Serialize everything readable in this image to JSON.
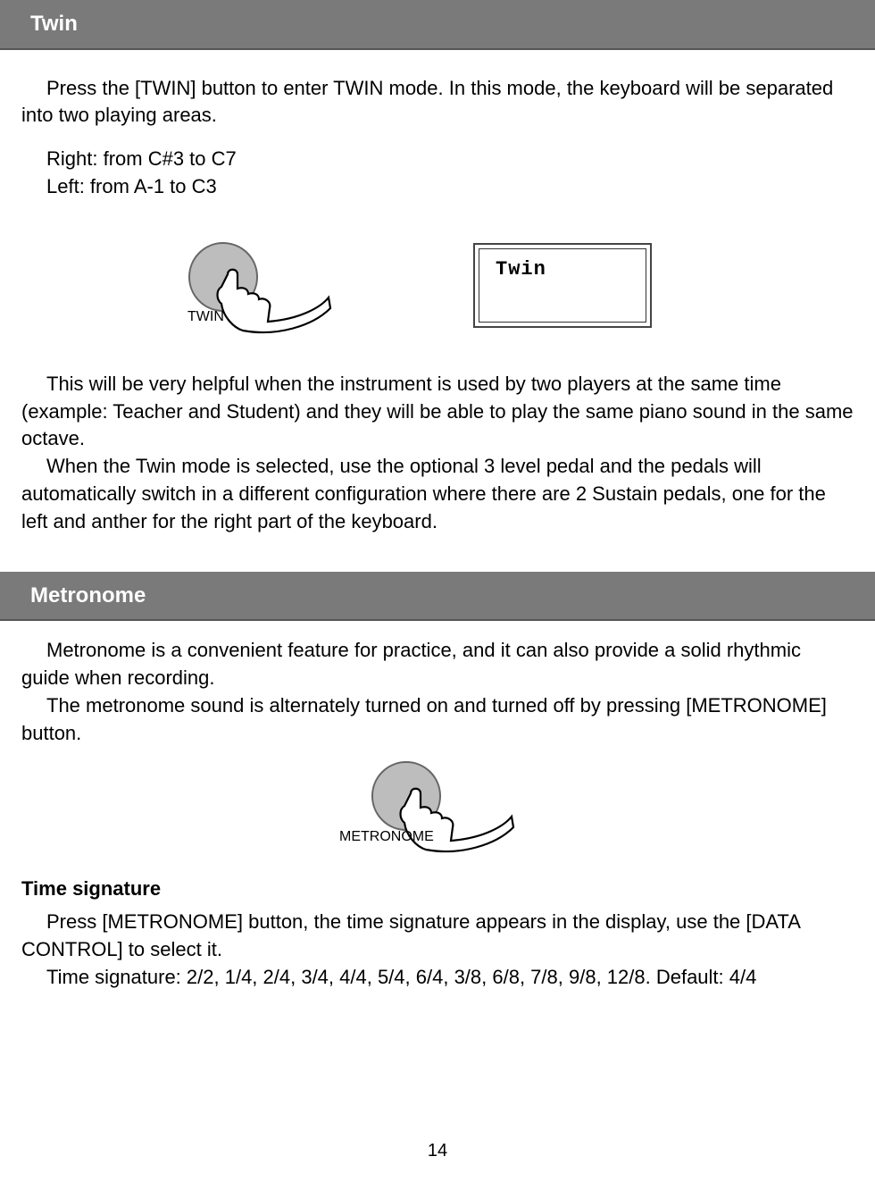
{
  "twin": {
    "header": "Twin",
    "p1": "Press the [TWIN] button to enter TWIN mode. In this mode, the keyboard will be separated into two playing areas.",
    "rangeRight": "Right: from C#3 to C7",
    "rangeLeft": "Left: from A-1 to C3",
    "buttonLabel": "TWIN",
    "lcdText": "Twin",
    "p2a": "This will be very helpful when the instrument is used by two players at the same time (example: Teacher and Student) and they will be able to play the same piano sound in the same octave.",
    "p2b": "When the Twin mode is selected, use the optional 3 level pedal and the pedals will automatically switch in a different configuration where there are 2 Sustain pedals, one for the left and anther for the right part of the keyboard."
  },
  "metronome": {
    "header": "Metronome",
    "p1a": "Metronome is a convenient feature for practice, and it can also provide a solid rhythmic guide when recording.",
    "p1b": "The metronome sound is alternately turned on and turned off by pressing [METRONOME] button.",
    "buttonLabel": "METRONOME",
    "subheading": "Time signature",
    "p2a": "Press [METRONOME] button, the time signature appears in the display, use the [DATA CONTROL] to select it.",
    "p2b": "Time signature: 2/2, 1/4, 2/4, 3/4, 4/4, 5/4, 6/4, 3/8, 6/8, 7/8, 9/8, 12/8. Default: 4/4"
  },
  "pageNumber": "14"
}
